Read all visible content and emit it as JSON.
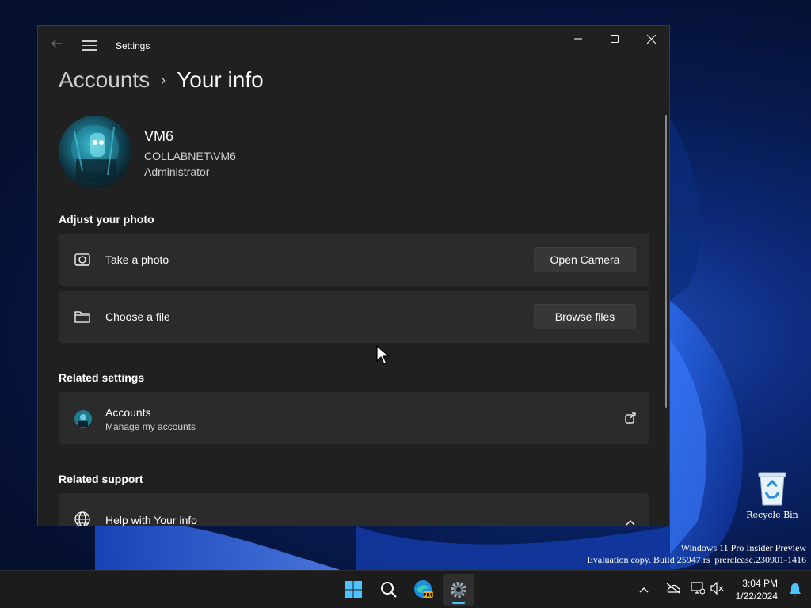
{
  "desktop": {
    "recycle_bin_label": "Recycle Bin",
    "watermark_line1": "Windows 11 Pro Insider Preview",
    "watermark_line2": "Evaluation copy. Build 25947.rs_prerelease.230901-1416"
  },
  "window": {
    "title": "Settings",
    "breadcrumb": {
      "parent": "Accounts",
      "separator": "›",
      "current": "Your info"
    },
    "profile": {
      "name": "VM6",
      "domain": "COLLABNET\\VM6",
      "role": "Administrator"
    },
    "adjust_photo": {
      "title": "Adjust your photo",
      "take_photo": {
        "icon": "camera-icon",
        "label": "Take a photo",
        "button": "Open Camera"
      },
      "choose_file": {
        "icon": "folder-icon",
        "label": "Choose a file",
        "button": "Browse files"
      }
    },
    "related_settings": {
      "title": "Related settings",
      "accounts": {
        "label": "Accounts",
        "sublabel": "Manage my accounts",
        "icon": "external-link-icon"
      }
    },
    "related_support": {
      "title": "Related support",
      "help": {
        "icon": "globe-icon",
        "label": "Help with Your info",
        "chevron": "chevron-up-icon"
      }
    }
  },
  "taskbar": {
    "items": [
      "start-icon",
      "search-icon",
      "edge-beta-icon",
      "settings-icon"
    ],
    "tray_icons": [
      "chevron-up-icon",
      "onedrive-icon",
      "network-icon",
      "volume-muted-icon"
    ],
    "time": "3:04 PM",
    "date": "1/22/2024",
    "notifications_icon": "bell-icon"
  },
  "colors": {
    "window_bg": "#202020",
    "card_bg": "#2b2b2b",
    "button_bg": "#373737",
    "accent": "#4cc2ff",
    "taskbar_bg": "#1c1c1c"
  }
}
